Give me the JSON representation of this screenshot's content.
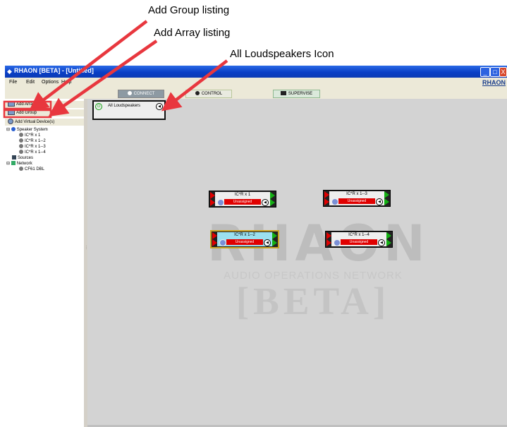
{
  "annotations": {
    "add_group": "Add Group listing",
    "add_array": "Add Array listing",
    "all_loudspeakers": "All Loudspeakers Icon"
  },
  "window": {
    "title": "RHAON [BETA] - [Untitled]",
    "menu": [
      "File",
      "Edit",
      "Options",
      "Help"
    ],
    "brand": "RHAON",
    "controls": [
      "_",
      "□",
      "X"
    ]
  },
  "toolbar": {
    "connect": "CONNECT",
    "control": "CONTROL",
    "supervise": "SUPERVISE"
  },
  "left_panel": {
    "add_array": "Add Array",
    "add_group": "Add Group",
    "add_virtual": "Add Virtual Device(s)",
    "tree": {
      "speaker_system": "Speaker System",
      "items": [
        "IC*R x 1",
        "IC*R x 1--2",
        "IC*R x 1--3",
        "IC*R x 1--4"
      ],
      "sources": "Sources",
      "network": "Network",
      "network_device": "CF61 DBL"
    }
  },
  "canvas": {
    "all_loudspeakers": "All Loudspeakers",
    "devices": [
      {
        "name": "IC*R x 1",
        "status": "Unassigned",
        "selected": false
      },
      {
        "name": "IC*R x 1--3",
        "status": "Unassigned",
        "selected": false
      },
      {
        "name": "IC*R x 1--2",
        "status": "Unassigned",
        "selected": true
      },
      {
        "name": "IC*R x 1--4",
        "status": "Unassigned",
        "selected": false
      }
    ],
    "watermark": {
      "logo": "RHAON",
      "subtitle": "AUDIO OPERATIONS NETWORK",
      "beta": "[BETA]"
    }
  },
  "colors": {
    "arrow": "#e8373e",
    "titlebar": "#0a3fc6",
    "unassigned": "#e00000",
    "output_triangle": "#13b013"
  }
}
